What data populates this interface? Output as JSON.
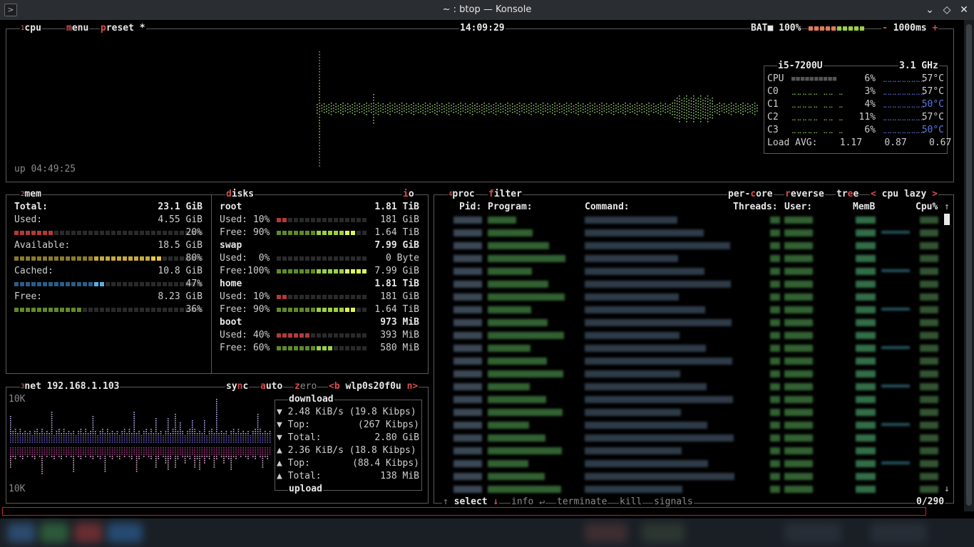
{
  "window": {
    "title": "~ : btop — Konsole"
  },
  "cpu": {
    "box_num": "1",
    "label": "cpu",
    "menu_label": "menu",
    "preset_label": "preset *",
    "clock": "14:09:29",
    "battery_label": "BAT■",
    "battery_pct": "100%",
    "minus": "-",
    "interval": "1000ms",
    "plus": "+",
    "uptime": "up 04:49:25",
    "model": "i5-7200U",
    "freq": "3.1 GHz",
    "rows": [
      {
        "name": "CPU",
        "pct": "6%",
        "temp": "57°C"
      },
      {
        "name": "C0",
        "pct": "3%",
        "temp": "57°C"
      },
      {
        "name": "C1",
        "pct": "4%",
        "temp": "50°C"
      },
      {
        "name": "C2",
        "pct": "11%",
        "temp": "57°C"
      },
      {
        "name": "C3",
        "pct": "6%",
        "temp": "50°C"
      }
    ],
    "load_label": "Load AVG:",
    "load": [
      "1.17",
      "0.87",
      "0.67"
    ]
  },
  "mem": {
    "box_num": "2",
    "label": "mem",
    "total_label": "Total:",
    "total": "23.1 GiB",
    "used_label": "Used:",
    "used": "4.55 GiB",
    "used_pct": "20%",
    "used_frac": 0.2,
    "avail_label": "Available:",
    "avail": "18.5 GiB",
    "avail_pct": "80%",
    "avail_frac": 0.8,
    "cached_label": "Cached:",
    "cached": "10.8 GiB",
    "cached_pct": "47%",
    "cached_frac": 0.47,
    "free_label": "Free:",
    "free": "8.23 GiB",
    "free_pct": "36%",
    "free_frac": 0.36
  },
  "disks": {
    "label": "disks",
    "io_label": "io",
    "items": [
      {
        "name": "root",
        "size": "1.81 TiB",
        "used_label": "Used: 10%",
        "used": "181 GiB",
        "used_frac": 0.1,
        "free_label": "Free: 90%",
        "free": "1.64 TiB",
        "free_frac": 0.9
      },
      {
        "name": "swap",
        "size": "7.99 GiB",
        "used_label": "Used:  0%",
        "used": "0 Byte",
        "used_frac": 0.0,
        "free_label": "Free:100%",
        "free": "7.99 GiB",
        "free_frac": 1.0
      },
      {
        "name": "home",
        "size": "1.81 TiB",
        "used_label": "Used: 10%",
        "used": "181 GiB",
        "used_frac": 0.1,
        "free_label": "Free: 90%",
        "free": "1.64 TiB",
        "free_frac": 0.9
      },
      {
        "name": "boot",
        "size": "973 MiB",
        "used_label": "Used: 40%",
        "used": "393 MiB",
        "used_frac": 0.4,
        "free_label": "Free: 60%",
        "free": "580 MiB",
        "free_frac": 0.6
      }
    ]
  },
  "net": {
    "box_num": "3",
    "label": "net",
    "ip": "192.168.1.103",
    "sync": "sync",
    "auto": "auto",
    "zero": "zero",
    "prev": "<b",
    "iface": "wlp0s20f0u",
    "next": "n>",
    "scale_top": "10K",
    "scale_bottom": "10K",
    "download_label": "download",
    "upload_label": "upload",
    "down_rate": "2.48 KiB/s (19.8 Kibps)",
    "down_top_label": "Top:",
    "down_top": "(267 Kibps)",
    "down_total_label": "Total:",
    "down_total": "2.80 GiB",
    "up_rate": "2.36 KiB/s (18.8 Kibps)",
    "up_top_label": "Top:",
    "up_top": "(88.4 Kibps)",
    "up_total_label": "Total:",
    "up_total": "138 MiB"
  },
  "proc": {
    "box_num": "4",
    "label": "proc",
    "filter": "filter",
    "per_core": "per-core",
    "reverse": "reverse",
    "tree": "tree",
    "sort_prev": "<",
    "sort": "cpu lazy",
    "sort_next": ">",
    "headers": [
      "Pid:",
      "Program:",
      "Command:",
      "Threads:",
      "User:",
      "MemB",
      "Cpu%"
    ],
    "footer": {
      "select": "select",
      "info": "info",
      "terminate": "terminate",
      "kill": "kill",
      "signals": "signals",
      "count": "0/290"
    }
  },
  "colors": {
    "accent": "#d84d4d",
    "border": "#5a5a5a",
    "green": "#8fd14f",
    "blue_temp": "#5a78e0"
  }
}
